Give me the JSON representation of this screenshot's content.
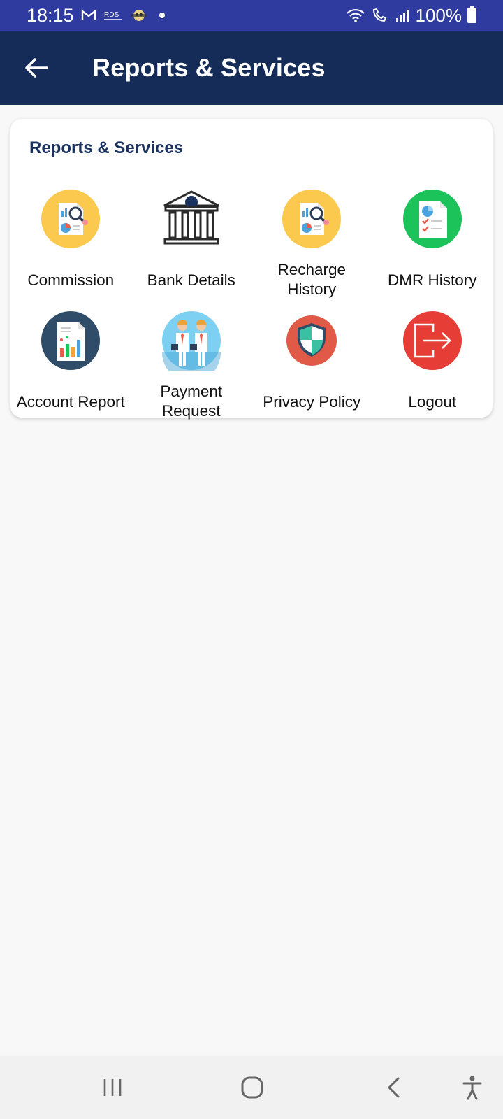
{
  "status_bar": {
    "time": "18:15",
    "notification_icons": [
      "gmail-icon",
      "rds-icon",
      "app-icon"
    ],
    "battery": "100%",
    "system_icons": [
      "wifi-icon",
      "volte-call-icon",
      "signal-icon",
      "battery-icon"
    ]
  },
  "app_bar": {
    "title": "Reports & Services",
    "back_icon": "arrow-left-icon"
  },
  "card": {
    "title": "Reports & Services",
    "items": [
      {
        "label": "Commission",
        "icon": "report-magnifier-icon",
        "color": "#fcc94f"
      },
      {
        "label": "Bank Details",
        "icon": "bank-icon",
        "color": "#ffffff"
      },
      {
        "label": "Recharge\nHistory",
        "icon": "report-magnifier-icon",
        "color": "#fcc94f"
      },
      {
        "label": "DMR History",
        "icon": "checklist-report-icon",
        "color": "#1cc25a"
      },
      {
        "label": "Account Report",
        "icon": "bar-chart-report-icon",
        "color": "#2f4d68"
      },
      {
        "label": "Payment\nRequest",
        "icon": "business-people-icon",
        "color": "#7ed0f2"
      },
      {
        "label": "Privacy Policy",
        "icon": "shield-icon",
        "color": "#e05a47"
      },
      {
        "label": "Logout",
        "icon": "logout-icon",
        "color": "#e63e36"
      }
    ]
  },
  "nav_bar": {
    "buttons": [
      "recent-apps-icon",
      "home-icon",
      "back-icon",
      "accessibility-icon"
    ]
  }
}
